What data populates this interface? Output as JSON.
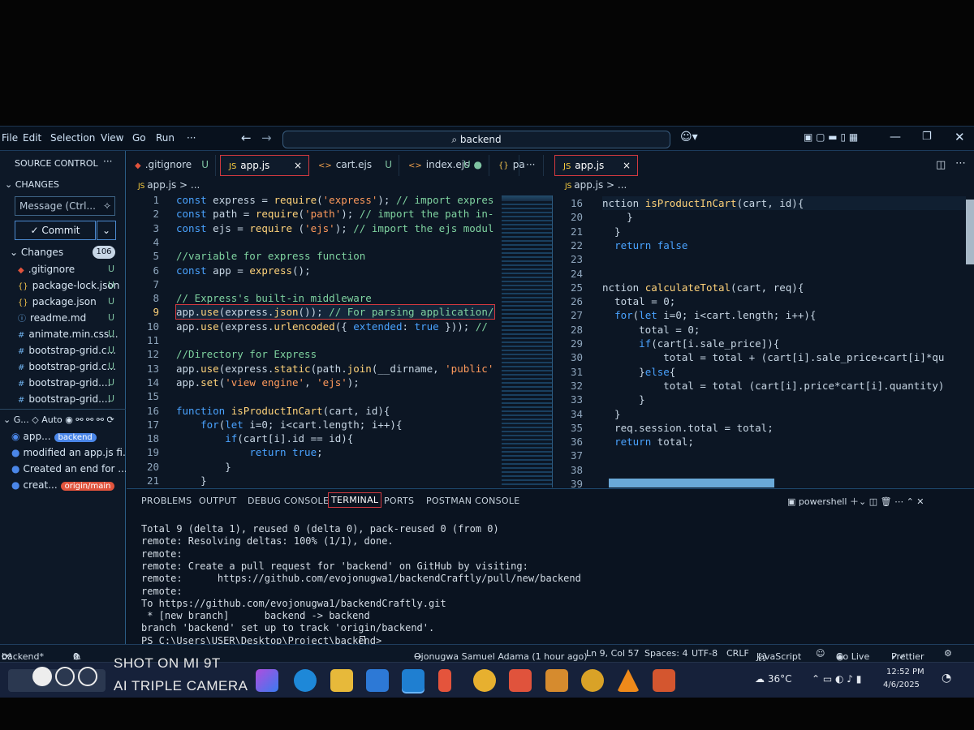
{
  "menu": [
    "File",
    "Edit",
    "Selection",
    "View",
    "Go",
    "Run",
    "···"
  ],
  "search": {
    "text": "backend"
  },
  "sidebar": {
    "title": "SOURCE CONTROL",
    "more": "···",
    "changes_header": "CHANGES",
    "message_placeholder": "Message (Ctrl...",
    "commit_label": "Commit",
    "changes_label": "Changes",
    "changes_count": "106",
    "files": [
      {
        "name": ".gitignore",
        "icon": "git-file-icon",
        "status": "U"
      },
      {
        "name": "package-lock.json",
        "icon": "braces-icon",
        "status": "U"
      },
      {
        "name": "package.json",
        "icon": "braces-icon",
        "status": "U"
      },
      {
        "name": "readme.md",
        "icon": "info-icon",
        "status": "U"
      },
      {
        "name": "animate.min.css...",
        "icon": "hash-icon",
        "status": "U"
      },
      {
        "name": "bootstrap-grid.c...",
        "icon": "hash-icon",
        "status": "U"
      },
      {
        "name": "bootstrap-grid.c...",
        "icon": "hash-icon",
        "status": "U"
      },
      {
        "name": "bootstrap-grid....",
        "icon": "hash-icon",
        "status": "U"
      },
      {
        "name": "bootstrap-grid....",
        "icon": "hash-icon",
        "status": "U"
      }
    ],
    "graph_header": "G...",
    "graph_auto": "Auto",
    "commits": [
      {
        "text": "app...",
        "badge": "backend"
      },
      {
        "text": "modified an app.js fi...",
        "badge": ""
      },
      {
        "text": "Created an end for ...",
        "badge": ""
      },
      {
        "text": "creat...",
        "badge": "origin/main"
      }
    ]
  },
  "tabs_left": [
    {
      "label": ".gitignore",
      "suffix": "U",
      "icon": "git-file-icon"
    },
    {
      "label": "app.js",
      "suffix": "×",
      "icon": "js-icon"
    },
    {
      "label": "cart.ejs",
      "suffix": "U",
      "icon": "code-icon"
    },
    {
      "label": "index.ejs",
      "suffix": "U ●",
      "icon": "code-icon"
    },
    {
      "label": "pa",
      "suffix": "",
      "icon": "braces-icon"
    }
  ],
  "tab_overflow": "···",
  "tabs_right": [
    {
      "label": "app.js",
      "suffix": "×",
      "icon": "js-icon"
    }
  ],
  "breadcrumb_left": "app.js > ...",
  "breadcrumb_right": "app.js > ...",
  "left_code": [
    {
      "n": "1",
      "t": "const express = require('express'); // import express fr"
    },
    {
      "n": "2",
      "t": "const path = require('path'); // import the path in-buil"
    },
    {
      "n": "3",
      "t": "const ejs = require ('ejs'); // import the ejs module"
    },
    {
      "n": "4",
      "t": ""
    },
    {
      "n": "5",
      "t": "//variable for express function"
    },
    {
      "n": "6",
      "t": "const app = express();"
    },
    {
      "n": "7",
      "t": ""
    },
    {
      "n": "8",
      "t": "// Express's built-in middleware"
    },
    {
      "n": "9",
      "t": "app.use(express.json()); // For parsing application/jsor"
    },
    {
      "n": "10",
      "t": "app.use(express.urlencoded({ extended: true })); // For"
    },
    {
      "n": "11",
      "t": ""
    },
    {
      "n": "12",
      "t": "//Directory for Express"
    },
    {
      "n": "13",
      "t": "app.use(express.static(path.join(__dirname, 'public')));"
    },
    {
      "n": "14",
      "t": "app.set('view engine', 'ejs');"
    },
    {
      "n": "15",
      "t": ""
    },
    {
      "n": "16",
      "t": "function isProductInCart(cart, id){"
    },
    {
      "n": "17",
      "t": "    for(let i=0; i<cart.length; i++){"
    },
    {
      "n": "18",
      "t": "        if(cart[i].id == id){"
    },
    {
      "n": "19",
      "t": "            return true;"
    },
    {
      "n": "20",
      "t": "        }"
    },
    {
      "n": "21",
      "t": "    }"
    }
  ],
  "right_code": [
    {
      "n": "16",
      "t": "nction isProductInCart(cart, id){"
    },
    {
      "n": "20",
      "t": "    }"
    },
    {
      "n": "21",
      "t": "  }"
    },
    {
      "n": "22",
      "t": "  return false"
    },
    {
      "n": "23",
      "t": ""
    },
    {
      "n": "24",
      "t": ""
    },
    {
      "n": "25",
      "t": "nction calculateTotal(cart, req){"
    },
    {
      "n": "26",
      "t": "  total = 0;"
    },
    {
      "n": "27",
      "t": "  for(let i=0; i<cart.length; i++){"
    },
    {
      "n": "28",
      "t": "      total = 0;"
    },
    {
      "n": "29",
      "t": "      if(cart[i.sale_price]){"
    },
    {
      "n": "30",
      "t": "          total = total + (cart[i].sale_price+cart[i]*qu"
    },
    {
      "n": "31",
      "t": "      }else{"
    },
    {
      "n": "32",
      "t": "          total = total (cart[i].price*cart[i].quantity)"
    },
    {
      "n": "33",
      "t": "      }"
    },
    {
      "n": "34",
      "t": "  }"
    },
    {
      "n": "35",
      "t": "  req.session.total = total;"
    },
    {
      "n": "36",
      "t": "  return total;"
    },
    {
      "n": "37",
      "t": ""
    },
    {
      "n": "38",
      "t": ""
    },
    {
      "n": "39",
      "t": ""
    }
  ],
  "panel_tabs": [
    "PROBLEMS",
    "OUTPUT",
    "DEBUG CONSOLE",
    "TERMINAL",
    "PORTS",
    "POSTMAN CONSOLE"
  ],
  "shell_label": "powershell",
  "terminal": [
    "Total 9 (delta 1), reused 0 (delta 0), pack-reused 0 (from 0)",
    "remote: Resolving deltas: 100% (1/1), done.",
    "remote:",
    "remote: Create a pull request for 'backend' on GitHub by visiting:",
    "remote:      https://github.com/evojonugwa1/backendCraftly/pull/new/backend",
    "remote:",
    "To https://github.com/evojonugwa1/backendCraftly.git",
    " * [new branch]      backend -> backend",
    "branch 'backend' set up to track 'origin/backend'.",
    "PS C:\\Users\\USER\\Desktop\\Project\\backend> "
  ],
  "status": {
    "branch": "backend*",
    "errors": "0",
    "warnings": "0",
    "blame": "Ojonugwa Samuel Adama (1 hour ago)",
    "position": "Ln 9, Col 57",
    "spaces": "Spaces: 4",
    "encoding": "UTF-8",
    "eol": "CRLF",
    "language": "JavaScript",
    "golive": "Go Live",
    "prettier": "Prettier"
  },
  "taskbar": {
    "temp": "36°C",
    "time": "12:52 PM",
    "date": "4/6/2025"
  },
  "watermark": {
    "line1": "SHOT ON MI 9T",
    "line2": "AI TRIPLE CAMERA"
  },
  "colors": {
    "accent": "#d2393f",
    "keyword": "#4aa3ff",
    "string": "#ff9a5c",
    "comment": "#7fd3a0",
    "function": "#ffd37a",
    "badge_blue": "#4a86e8",
    "badge_red": "#e0533c"
  }
}
